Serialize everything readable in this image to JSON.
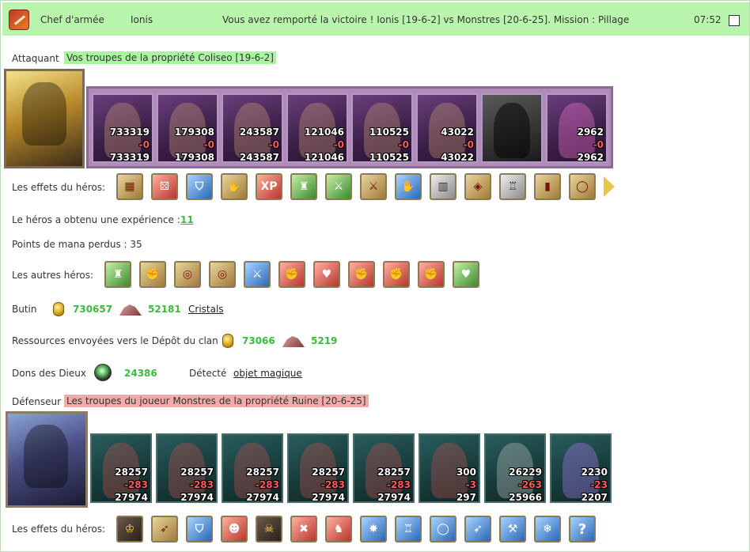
{
  "header": {
    "role": "Chef d'armée",
    "player": "Ionis",
    "message": "Vous avez remporté la victoire ! Ionis [19-6-2] vs Monstres [20-6-25]. Mission : Pillage",
    "time": "07:52"
  },
  "attacker": {
    "label": "Attaquant",
    "description": "Vos troupes de la propriété Coliseo [19-6-2]",
    "units": [
      {
        "start": "733319",
        "loss": "-0",
        "end": "733319"
      },
      {
        "start": "179308",
        "loss": "-0",
        "end": "179308"
      },
      {
        "start": "243587",
        "loss": "-0",
        "end": "243587"
      },
      {
        "start": "121046",
        "loss": "-0",
        "end": "121046"
      },
      {
        "start": "110525",
        "loss": "-0",
        "end": "110525"
      },
      {
        "start": "43022",
        "loss": "-0",
        "end": "43022"
      },
      {
        "start": "",
        "loss": "",
        "end": ""
      },
      {
        "start": "2962",
        "loss": "-0",
        "end": "2962"
      }
    ],
    "effects_label": "Les effets du héros:",
    "effects": [
      "fort-icon",
      "dice-icon",
      "shield-icon",
      "handshake-icon",
      "xp-icon",
      "xp-hero-icon",
      "sword-icon",
      "handshake-sword-icon",
      "hand-icon",
      "barrel-icon",
      "lantern-icon",
      "armor-icon",
      "boots-icon",
      "ring-icon"
    ],
    "effects_xp_text": "XP"
  },
  "experience": {
    "label": "Le héros a obtenu une expérience :",
    "value": "11"
  },
  "mana": {
    "label": "Points de mana perdus : 35"
  },
  "other_heroes": {
    "label": "Les autres héros:",
    "icons": [
      "sword-statue-icon",
      "fist-icon",
      "coins-hand-icon",
      "coins-hand-2-icon",
      "sword-icon",
      "fist-red-icon",
      "heart-sword-icon",
      "fist-red-2-icon",
      "fist-red-3-icon",
      "fist-red-4-icon",
      "heart-statue-icon"
    ]
  },
  "loot": {
    "label": "Butin",
    "gold": "730657",
    "crystals": "52181",
    "crystals_link": "Cristals"
  },
  "clan": {
    "label": "Ressources envoyées vers le Dépôt du clan",
    "gold": "73066",
    "crystals": "5219"
  },
  "gifts": {
    "label": "Dons des Dieux",
    "value": "24386",
    "detected_label": "Détecté",
    "detected_link": "objet magique"
  },
  "defender": {
    "label": "Défenseur",
    "description": "Les troupes du joueur Monstres de la propriété Ruine [20-6-25]",
    "units": [
      {
        "start": "28257",
        "loss": "-283",
        "end": "27974"
      },
      {
        "start": "28257",
        "loss": "-283",
        "end": "27974"
      },
      {
        "start": "28257",
        "loss": "-283",
        "end": "27974"
      },
      {
        "start": "28257",
        "loss": "-283",
        "end": "27974"
      },
      {
        "start": "28257",
        "loss": "-283",
        "end": "27974"
      },
      {
        "start": "300",
        "loss": "-3",
        "end": "297"
      },
      {
        "start": "26229",
        "loss": "-263",
        "end": "25966"
      },
      {
        "start": "2230",
        "loss": "-23",
        "end": "2207"
      }
    ],
    "effects_label": "Les effets du héros:",
    "effects": [
      "helmet-icon",
      "arrows-icon",
      "shield-icon",
      "ogre-icon",
      "skeleton-icon",
      "axes-icon",
      "lion-icon",
      "ice-spikes-icon",
      "ice-armor-icon",
      "ice-ring-icon",
      "ice-bow-icon",
      "ice-hammer-icon",
      "ice-crystal-icon",
      "question-icon"
    ],
    "question_text": "?"
  },
  "colors": {
    "header_bg": "#b9f5ac",
    "attacker_hl": "#a9f5a0",
    "defender_hl": "#f5a9a9",
    "value_green": "#3cba3c"
  }
}
